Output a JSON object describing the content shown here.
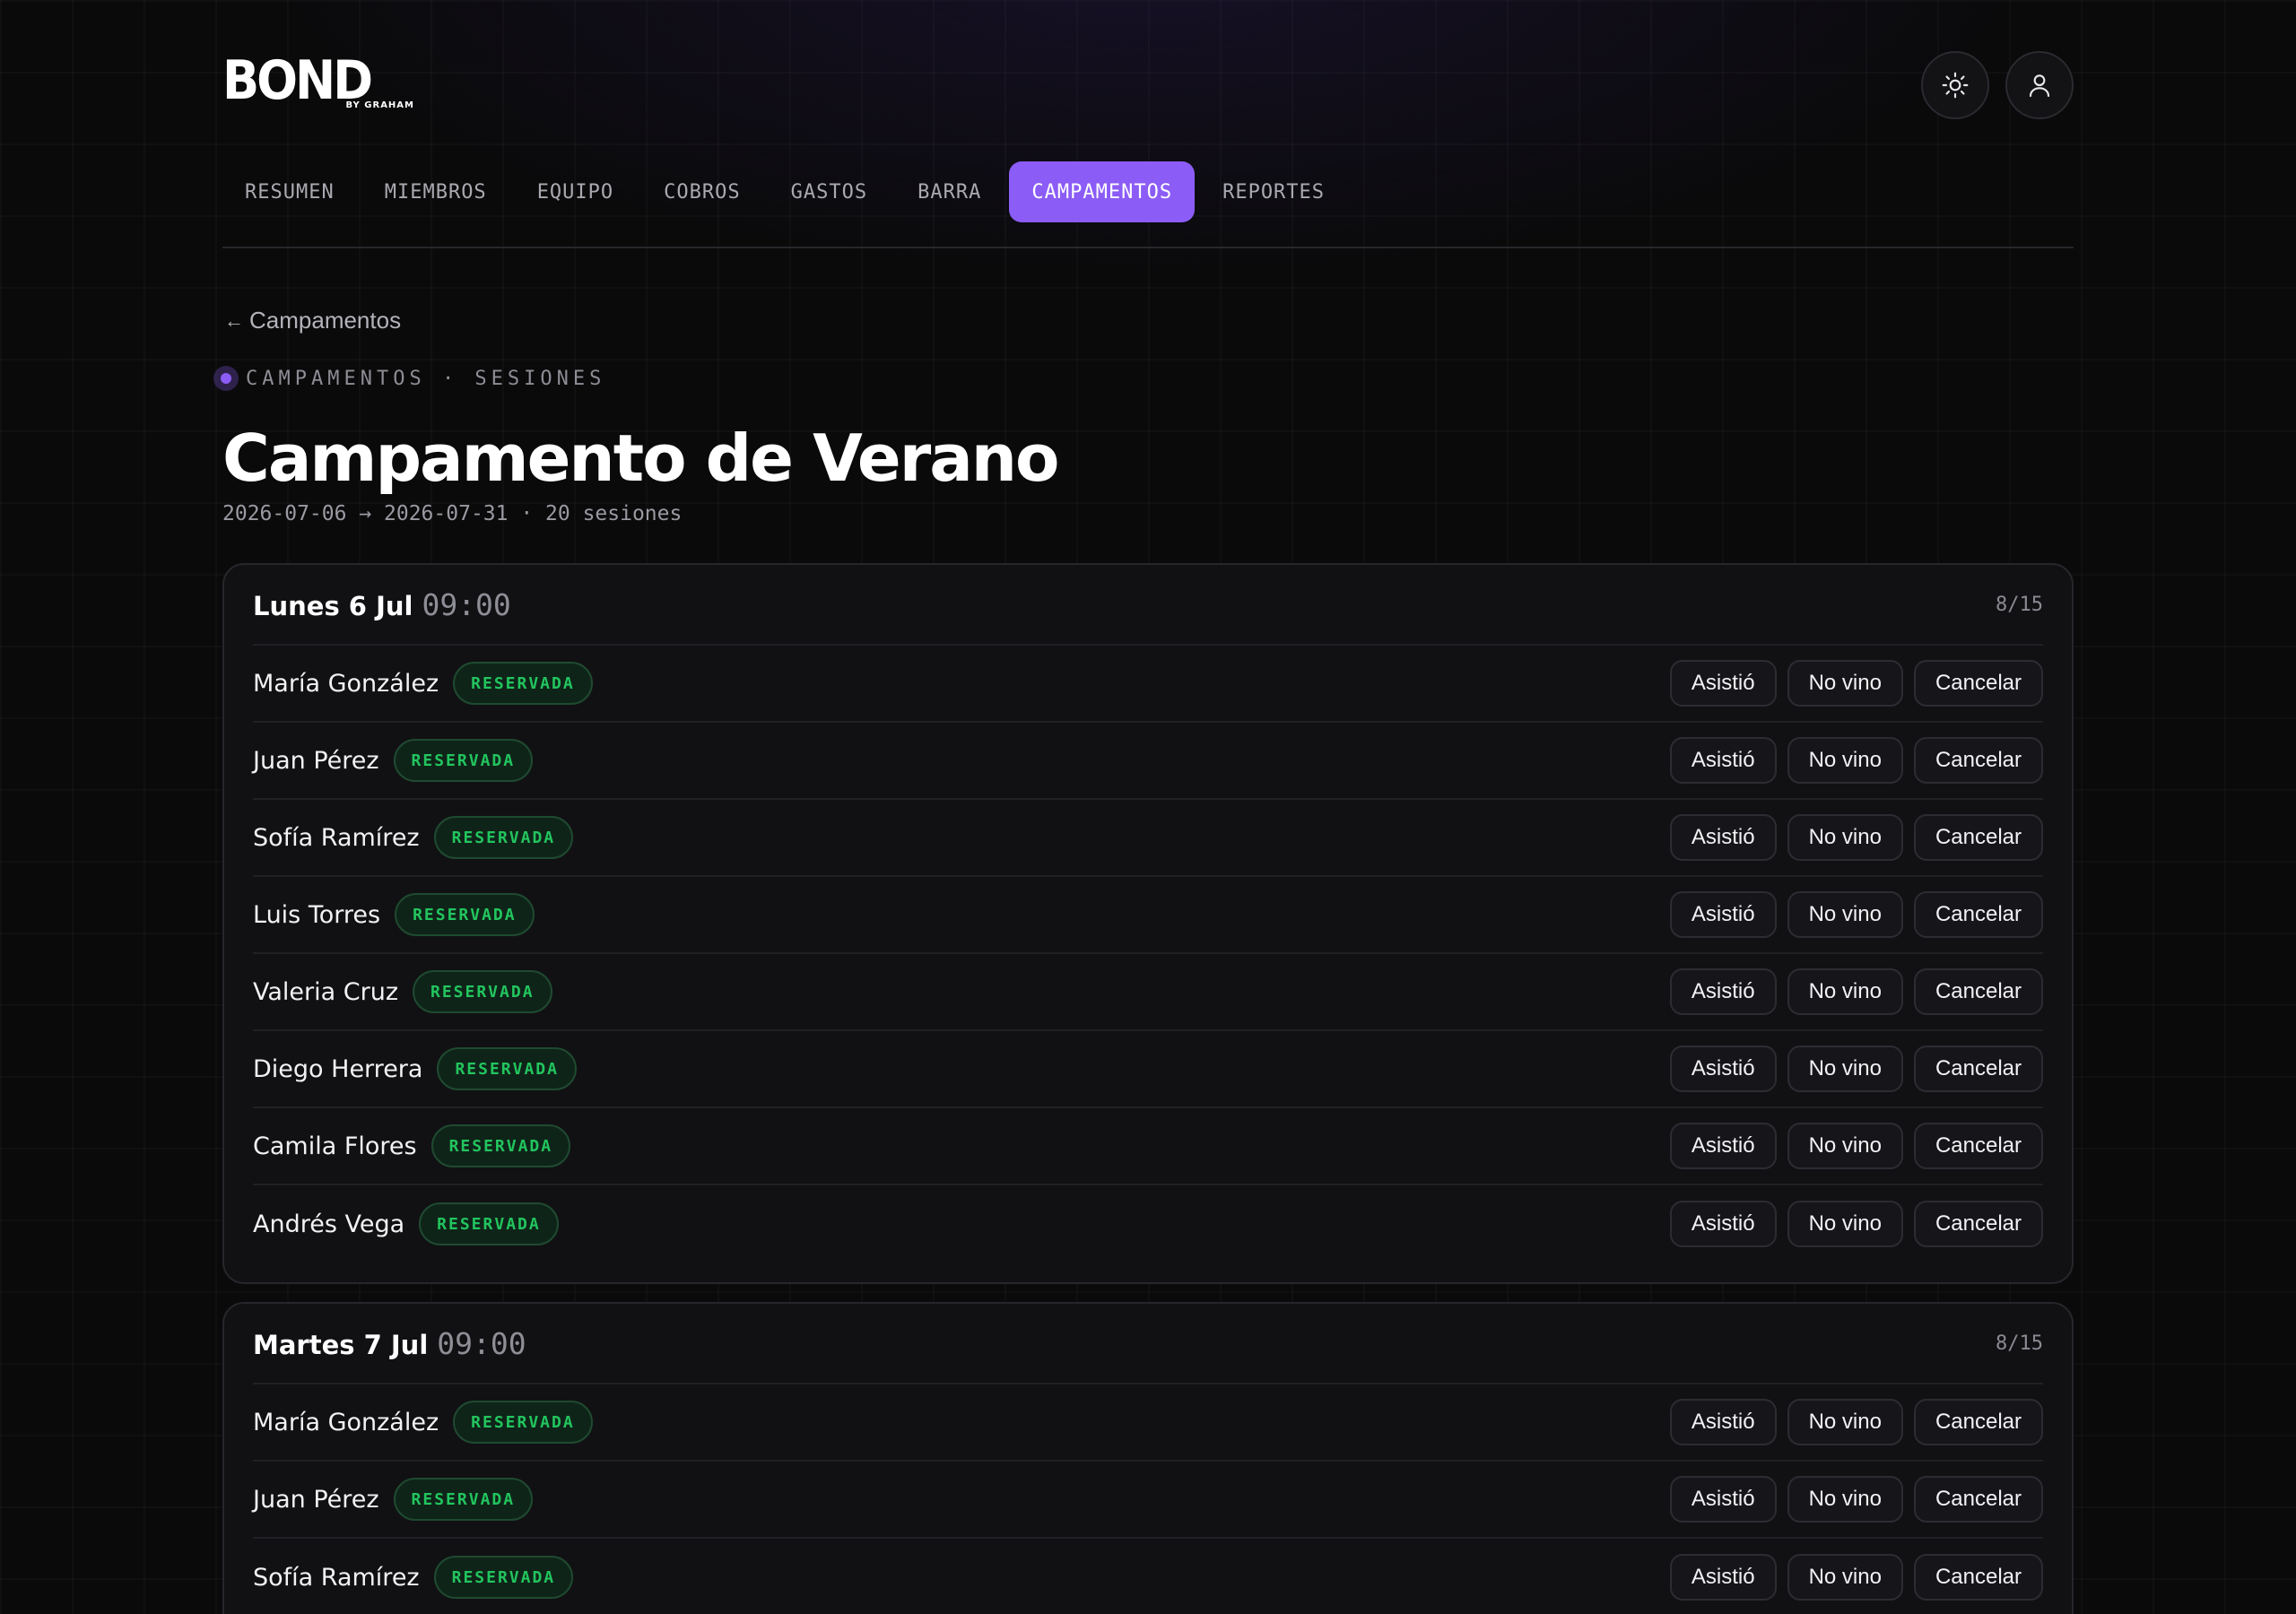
{
  "brand": {
    "word": "BOND",
    "sub": "BY GRAHAM"
  },
  "header": {
    "icons": {
      "theme": "sun-icon",
      "user": "user-icon"
    }
  },
  "nav": {
    "tabs": [
      {
        "label": "RESUMEN",
        "active": false
      },
      {
        "label": "MIEMBROS",
        "active": false
      },
      {
        "label": "EQUIPO",
        "active": false
      },
      {
        "label": "COBROS",
        "active": false
      },
      {
        "label": "GASTOS",
        "active": false
      },
      {
        "label": "BARRA",
        "active": false
      },
      {
        "label": "CAMPAMENTOS",
        "active": true
      },
      {
        "label": "REPORTES",
        "active": false
      }
    ]
  },
  "back": {
    "arrow": "←",
    "label": "Campamentos"
  },
  "eyebrow": "CAMPAMENTOS · SESIONES",
  "page": {
    "title": "Campamento de Verano",
    "subtitle": "2026-07-06 → 2026-07-31 · 20 sesiones"
  },
  "actions": {
    "attended": "Asistió",
    "no_show": "No vino",
    "cancel": "Cancelar"
  },
  "colors": {
    "accent": "#8b5cf6",
    "status_green": "#22c55e",
    "background": "#0a0a0b",
    "card": "#111114"
  },
  "sessions": [
    {
      "day": "Lunes 6 Jul",
      "time": "09:00",
      "capacity": "8/15",
      "attendees": [
        {
          "name": "María González",
          "status": "RESERVADA"
        },
        {
          "name": "Juan Pérez",
          "status": "RESERVADA"
        },
        {
          "name": "Sofía Ramírez",
          "status": "RESERVADA"
        },
        {
          "name": "Luis Torres",
          "status": "RESERVADA"
        },
        {
          "name": "Valeria Cruz",
          "status": "RESERVADA"
        },
        {
          "name": "Diego Herrera",
          "status": "RESERVADA"
        },
        {
          "name": "Camila Flores",
          "status": "RESERVADA"
        },
        {
          "name": "Andrés Vega",
          "status": "RESERVADA"
        }
      ]
    },
    {
      "day": "Martes 7 Jul",
      "time": "09:00",
      "capacity": "8/15",
      "attendees": [
        {
          "name": "María González",
          "status": "RESERVADA"
        },
        {
          "name": "Juan Pérez",
          "status": "RESERVADA"
        },
        {
          "name": "Sofía Ramírez",
          "status": "RESERVADA"
        }
      ]
    }
  ]
}
